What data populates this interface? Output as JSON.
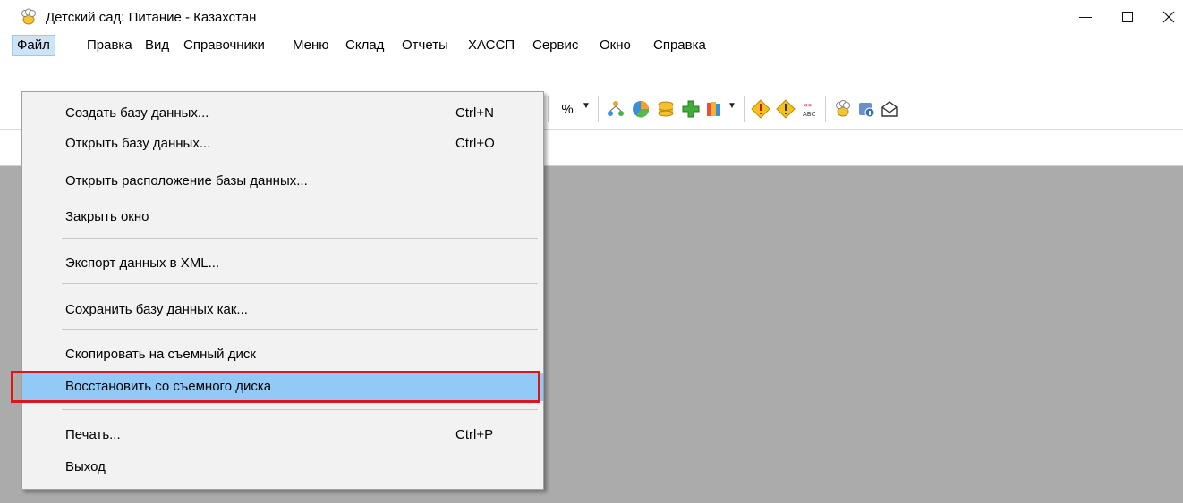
{
  "window": {
    "title": "Детский сад: Питание - Казахстан",
    "icon": "chef-hat-icon"
  },
  "menubar": [
    {
      "label": "Файл",
      "active": true
    },
    {
      "label": "Правка"
    },
    {
      "label": "Вид"
    },
    {
      "label": "Справочники"
    },
    {
      "label": "Меню"
    },
    {
      "label": "Склад"
    },
    {
      "label": "Отчеты"
    },
    {
      "label": "ХАССП"
    },
    {
      "label": "Сервис"
    },
    {
      "label": "Окно"
    },
    {
      "label": "Справка"
    }
  ],
  "toolbar": {
    "percent_label": "%",
    "icons": [
      "percent-icon",
      "hierarchy-icon",
      "pie-chart-icon",
      "coins-icon",
      "plus-icon",
      "books-icon",
      "warning-diamond-icon",
      "warning-diamond-icon",
      "spellcheck-icon",
      "chef-hat-icon",
      "info-icon",
      "mail-icon"
    ]
  },
  "file_menu": {
    "items": [
      {
        "label": "Создать базу данных...",
        "shortcut": "Ctrl+N"
      },
      {
        "label": "Открыть базу данных...",
        "shortcut": "Ctrl+O"
      },
      {
        "label": "Открыть расположение базы данных...",
        "shortcut": ""
      },
      {
        "label": "Закрыть окно",
        "shortcut": ""
      },
      {
        "label": "Экспорт данных в XML...",
        "shortcut": ""
      },
      {
        "label": "Сохранить базу данных как...",
        "shortcut": ""
      },
      {
        "label": "Скопировать на съемный диск",
        "shortcut": ""
      },
      {
        "label": "Восстановить со съемного диска",
        "shortcut": "",
        "highlighted": true
      },
      {
        "label": "Печать...",
        "shortcut": "Ctrl+P"
      },
      {
        "label": "Выход",
        "shortcut": ""
      }
    ]
  },
  "colors": {
    "highlight": "#91c9f7",
    "annotation_border": "#e3131a",
    "workspace": "#ababab"
  }
}
